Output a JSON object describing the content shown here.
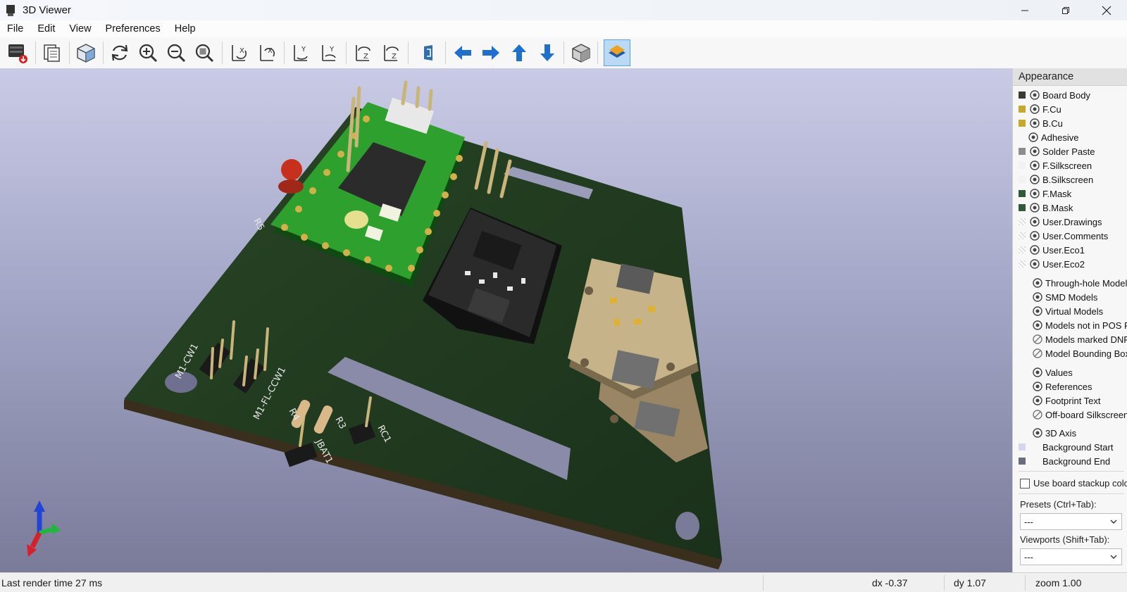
{
  "window": {
    "title": "3D Viewer"
  },
  "menu": [
    "File",
    "Edit",
    "View",
    "Preferences",
    "Help"
  ],
  "toolbar": {
    "tools": [
      "render-raytraced",
      "copy-to-clipboard",
      "view-iso",
      "reload",
      "zoom-in",
      "zoom-out",
      "zoom-fit",
      "rotate-x-cw",
      "rotate-x-ccw",
      "rotate-y-cw",
      "rotate-y-ccw",
      "rotate-z-cw",
      "rotate-z-ccw",
      "flip-board",
      "pan-left",
      "pan-right",
      "pan-up",
      "pan-down",
      "toggle-orthographic",
      "toggle-layers-manager"
    ],
    "active": "toggle-layers-manager"
  },
  "viewport": {
    "board_labels": [
      "M1-CW1",
      "M1-FL-CCW1",
      "R4",
      "R3",
      "RC1",
      "JBAT1",
      "R5"
    ]
  },
  "appearance": {
    "header": "Appearance",
    "layers": [
      {
        "name": "Board Body",
        "color": "#3d3a34",
        "visible": true
      },
      {
        "name": "F.Cu",
        "color": "#c7a92a",
        "visible": true
      },
      {
        "name": "B.Cu",
        "color": "#c7a92a",
        "visible": true
      },
      {
        "name": "Adhesive",
        "color": "",
        "visible": true
      },
      {
        "name": "Solder Paste",
        "color": "#8c8c8c",
        "visible": true
      },
      {
        "name": "F.Silkscreen",
        "color": "#f2f2f2",
        "visible": true
      },
      {
        "name": "B.Silkscreen",
        "color": "#f2f2f2",
        "visible": true
      },
      {
        "name": "F.Mask",
        "color": "#2f5a3a",
        "visible": true
      },
      {
        "name": "B.Mask",
        "color": "#2f5a3a",
        "visible": true
      },
      {
        "name": "User.Drawings",
        "color": "#e6e6e6",
        "visible": true
      },
      {
        "name": "User.Comments",
        "color": "#e6e6e6",
        "visible": true
      },
      {
        "name": "User.Eco1",
        "color": "#e6e6e6",
        "visible": true
      },
      {
        "name": "User.Eco2",
        "color": "#e6e6e6",
        "visible": true
      }
    ],
    "objects": [
      {
        "name": "Through-hole Models",
        "visible": true
      },
      {
        "name": "SMD Models",
        "visible": true
      },
      {
        "name": "Virtual Models",
        "visible": true
      },
      {
        "name": "Models not in POS File",
        "visible": true
      },
      {
        "name": "Models marked DNP",
        "visible": false
      },
      {
        "name": "Model Bounding Boxes",
        "visible": false
      },
      {
        "name": "Values",
        "visible": true
      },
      {
        "name": "References",
        "visible": true
      },
      {
        "name": "Footprint Text",
        "visible": true
      },
      {
        "name": "Off-board Silkscreen",
        "visible": false
      },
      {
        "name": "3D Axis",
        "visible": true
      },
      {
        "name": "Background Start",
        "color": "#d5d5ec",
        "visible": null
      },
      {
        "name": "Background End",
        "color": "#6b6b80",
        "visible": null
      }
    ],
    "use_stackup_label": "Use board stackup colors",
    "presets_label": "Presets (Ctrl+Tab):",
    "presets_value": "---",
    "viewports_label": "Viewports (Shift+Tab):",
    "viewports_value": "---"
  },
  "status": {
    "render_time": "Last render time 27 ms",
    "dx": "dx -0.37",
    "dy": "dy 1.07",
    "zoom": "zoom 1.00"
  }
}
